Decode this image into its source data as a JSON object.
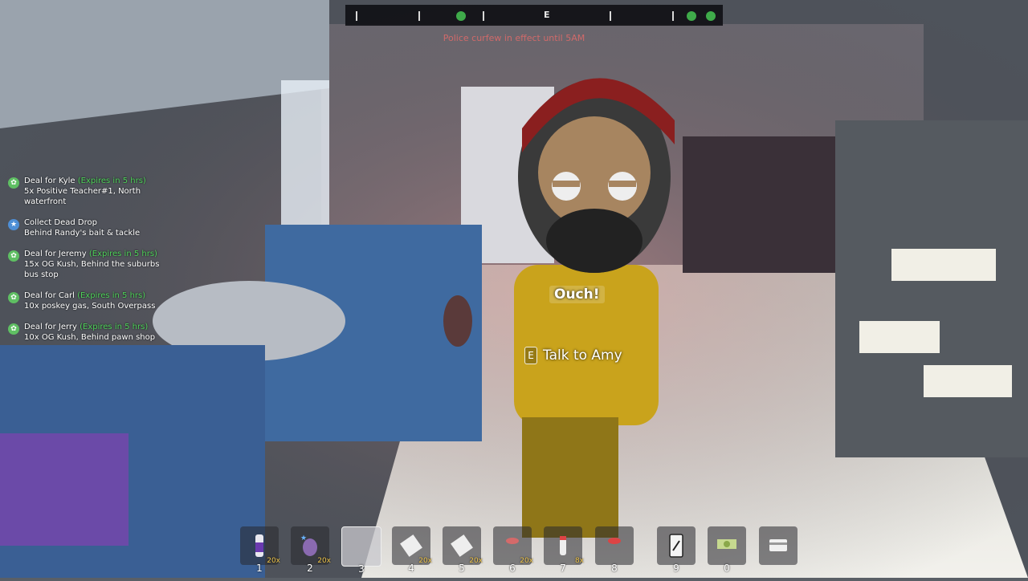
{
  "hud": {
    "compass": {
      "heading": "E"
    },
    "curfew_notice": "Police curfew in effect until 5AM",
    "interaction": {
      "key": "E",
      "label": "Talk to Amy"
    },
    "npc_speech": "Ouch!"
  },
  "quests": [
    {
      "icon": "weed-leaf-icon",
      "title": "Deal for Kyle",
      "expires": "(Expires in 5 hrs)",
      "desc": "5x Positive Teacher#1, North waterfront"
    },
    {
      "icon": "star-icon",
      "title": "Collect Dead Drop",
      "expires": "",
      "desc": "Behind Randy's bait & tackle"
    },
    {
      "icon": "weed-leaf-icon",
      "title": "Deal for Jeremy",
      "expires": "(Expires in 5 hrs)",
      "desc": "15x OG Kush, Behind the suburbs bus stop"
    },
    {
      "icon": "weed-leaf-icon",
      "title": "Deal for Carl",
      "expires": "(Expires in 5 hrs)",
      "desc": "10x poskey gas, South Overpass"
    },
    {
      "icon": "weed-leaf-icon",
      "title": "Deal for Jerry",
      "expires": "(Expires in 5 hrs)",
      "desc": "10x OG Kush, Behind pawn shop"
    }
  ],
  "hotbar": [
    {
      "num": "1",
      "qty": "20x",
      "icon": "product-jar-icon"
    },
    {
      "num": "2",
      "qty": "20x",
      "icon": "weed-bud-icon"
    },
    {
      "num": "3",
      "qty": "",
      "icon": "empty-slot"
    },
    {
      "num": "4",
      "qty": "20x",
      "icon": "baggie-icon"
    },
    {
      "num": "5",
      "qty": "20x",
      "icon": "baggie-icon"
    },
    {
      "num": "6",
      "qty": "20x",
      "icon": "pill-icon"
    },
    {
      "num": "7",
      "qty": "8x",
      "icon": "jar-icon"
    },
    {
      "num": "8",
      "qty": "",
      "icon": "jar-icon"
    },
    {
      "num": "9",
      "qty": "",
      "icon": "phone-icon"
    },
    {
      "num": "0",
      "qty": "",
      "icon": "cash-icon"
    },
    {
      "num": "",
      "qty": "",
      "icon": "card-icon"
    }
  ],
  "colors": {
    "accent_green": "#4fd25a",
    "curfew_red": "#d06a6a",
    "qty_yellow": "#f0c64c"
  }
}
